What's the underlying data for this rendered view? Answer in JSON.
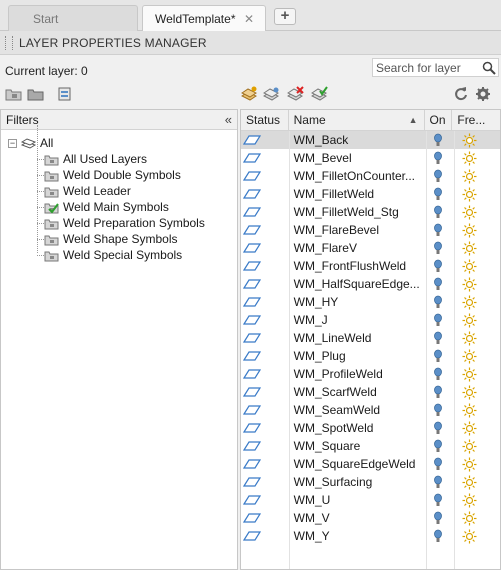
{
  "tabs": {
    "start_label": "Start",
    "active_label": "WeldTemplate*",
    "close_glyph": "✕",
    "add_glyph": "+"
  },
  "palette": {
    "title": "LAYER PROPERTIES MANAGER",
    "current_layer": "Current layer: 0",
    "search_placeholder": "Search for layer"
  },
  "filters": {
    "header": "Filters",
    "collapse_glyph": "«",
    "root_label": "All",
    "items": [
      {
        "label": "All Used Layers",
        "active": false
      },
      {
        "label": "Weld Double Symbols",
        "active": false
      },
      {
        "label": "Weld Leader",
        "active": false
      },
      {
        "label": "Weld Main Symbols",
        "active": true
      },
      {
        "label": "Weld Preparation Symbols",
        "active": false
      },
      {
        "label": "Weld Shape Symbols",
        "active": false
      },
      {
        "label": "Weld Special Symbols",
        "active": false
      }
    ]
  },
  "layers": {
    "columns": {
      "status": "Status",
      "name": "Name",
      "on": "On",
      "freeze": "Fre..."
    },
    "rows": [
      {
        "name": "WM_Back",
        "selected": true
      },
      {
        "name": "WM_Bevel"
      },
      {
        "name": "WM_FilletOnCounter..."
      },
      {
        "name": "WM_FilletWeld"
      },
      {
        "name": "WM_FilletWeld_Stg"
      },
      {
        "name": "WM_FlareBevel"
      },
      {
        "name": "WM_FlareV"
      },
      {
        "name": "WM_FrontFlushWeld"
      },
      {
        "name": "WM_HalfSquareEdge..."
      },
      {
        "name": "WM_HY"
      },
      {
        "name": "WM_J"
      },
      {
        "name": "WM_LineWeld"
      },
      {
        "name": "WM_Plug"
      },
      {
        "name": "WM_ProfileWeld"
      },
      {
        "name": "WM_ScarfWeld"
      },
      {
        "name": "WM_SeamWeld"
      },
      {
        "name": "WM_SpotWeld"
      },
      {
        "name": "WM_Square"
      },
      {
        "name": "WM_SquareEdgeWeld"
      },
      {
        "name": "WM_Surfacing"
      },
      {
        "name": "WM_U"
      },
      {
        "name": "WM_V"
      },
      {
        "name": "WM_Y"
      }
    ]
  },
  "icons": {
    "bulb_on_color": "#5b8fc8",
    "sun_color": "#d9a400",
    "check_color": "#2ea02e"
  }
}
